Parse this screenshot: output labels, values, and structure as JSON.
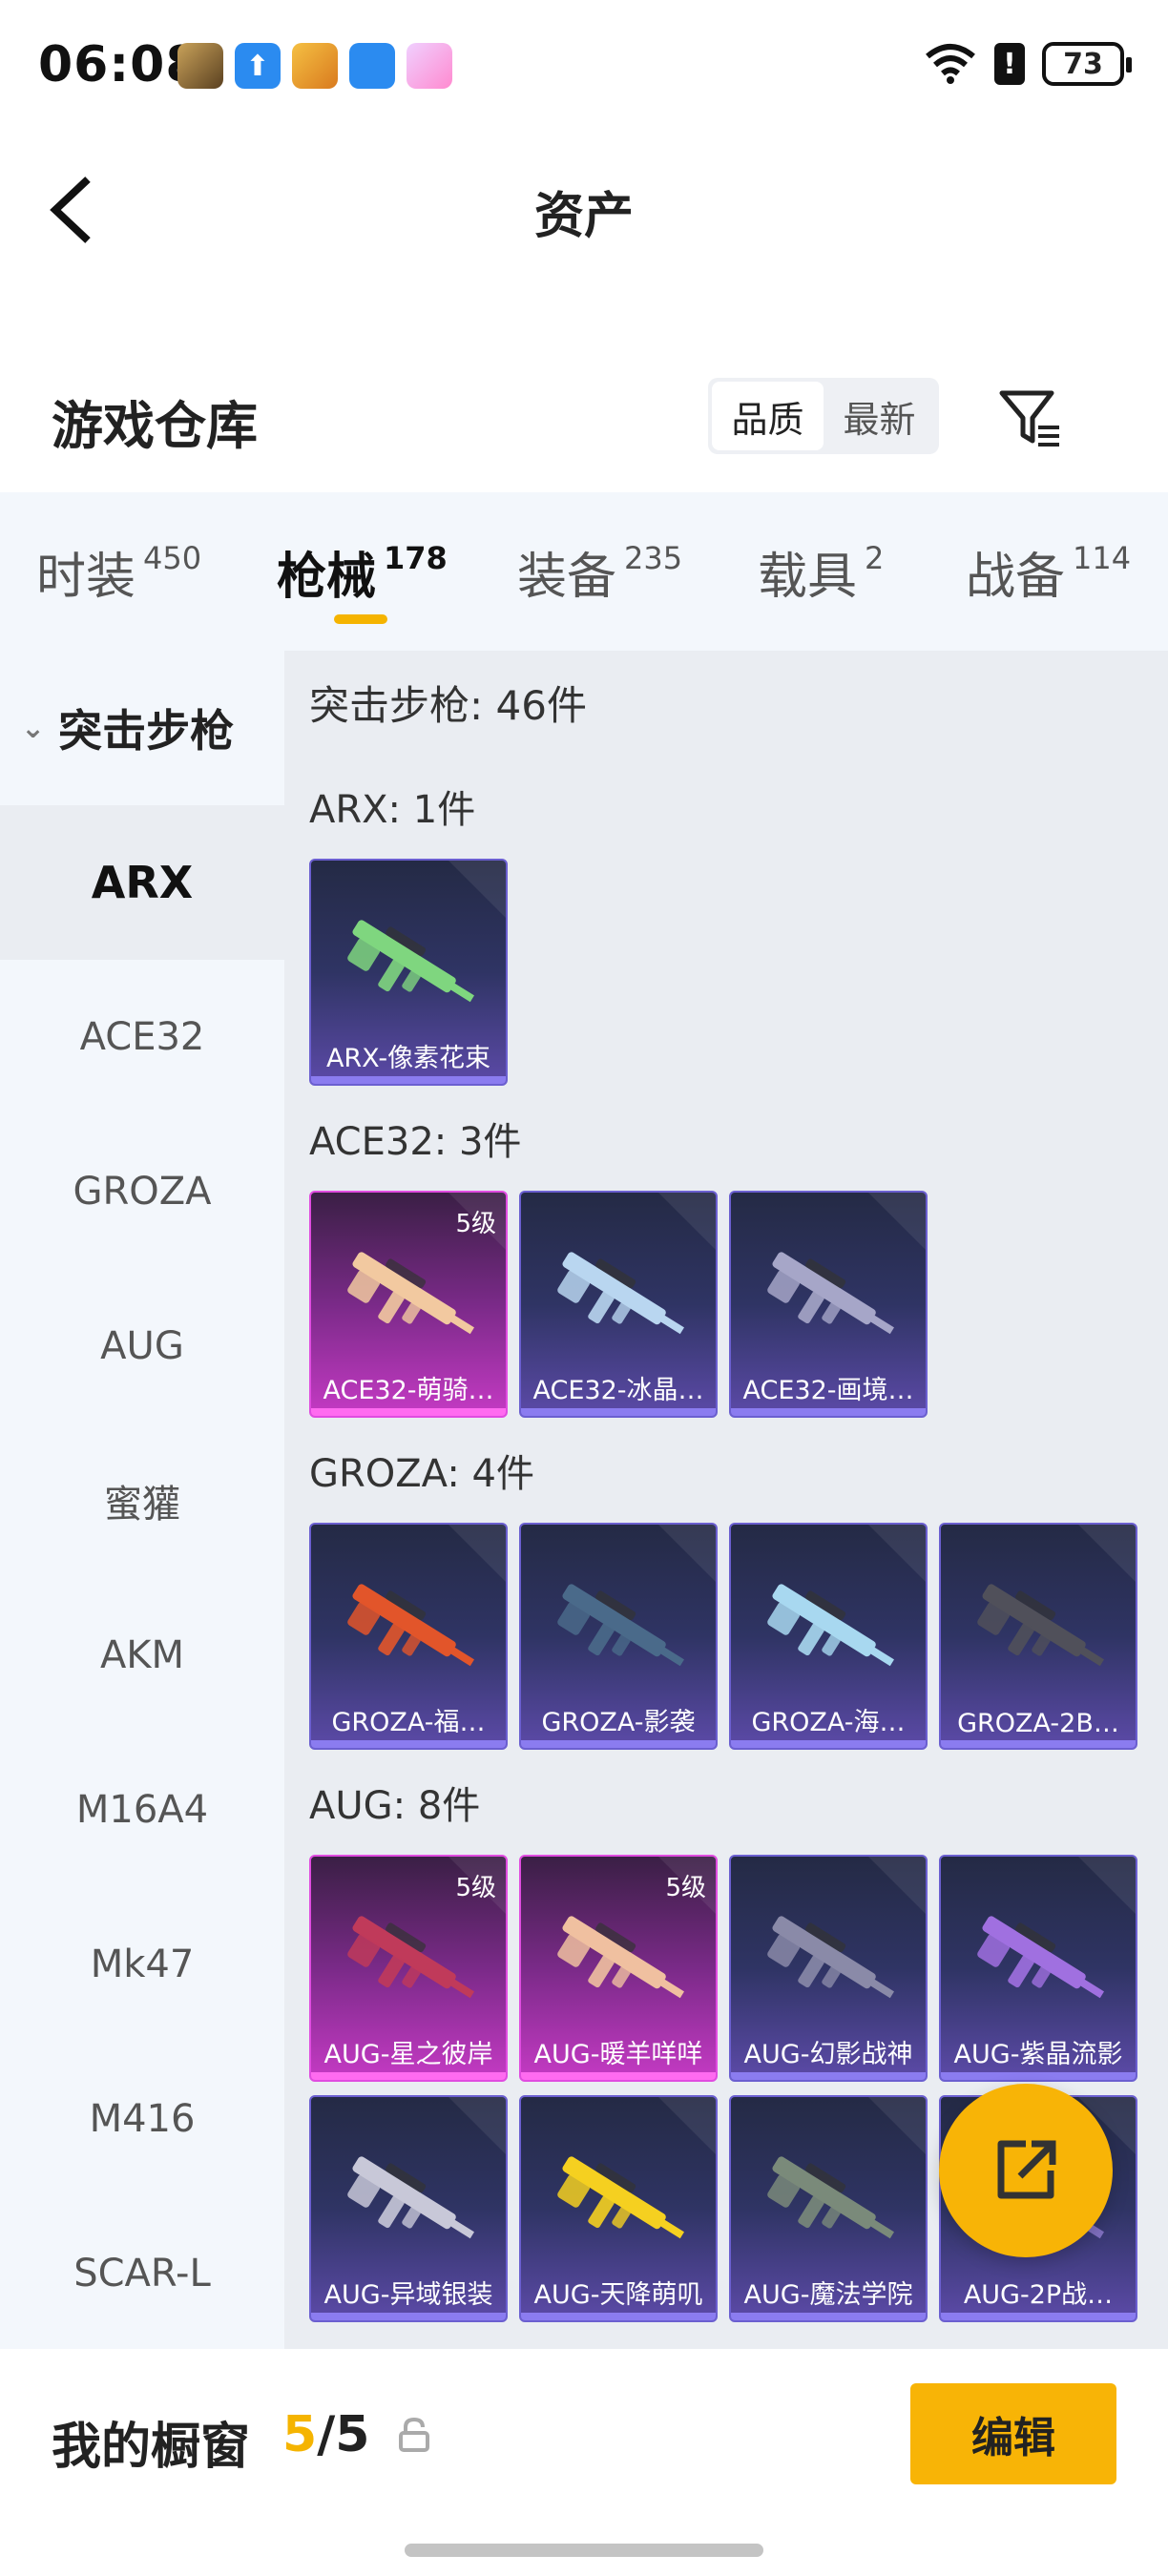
{
  "status_bar": {
    "time": "06:08",
    "battery": "73"
  },
  "header": {
    "title": "资产"
  },
  "warehouse": {
    "title": "游戏仓库",
    "sort_options": [
      "品质",
      "最新"
    ]
  },
  "tabs": [
    {
      "label": "时装",
      "count": "450"
    },
    {
      "label": "枪械",
      "count": "178"
    },
    {
      "label": "装备",
      "count": "235"
    },
    {
      "label": "载具",
      "count": "2"
    },
    {
      "label": "战备",
      "count": "114"
    }
  ],
  "sidebar": {
    "group": "突击步枪",
    "items": [
      "ARX",
      "ACE32",
      "GROZA",
      "AUG",
      "蜜獾",
      "AKM",
      "M16A4",
      "Mk47",
      "M416",
      "SCAR-L"
    ]
  },
  "content": {
    "category_title": "突击步枪: 46件",
    "sections": [
      {
        "title": "ARX: 1件",
        "items": [
          {
            "label": "ARX-像素花束",
            "badge": ""
          }
        ]
      },
      {
        "title": "ACE32: 3件",
        "items": [
          {
            "label": "ACE32-萌骑…",
            "badge": "5级"
          },
          {
            "label": "ACE32-冰晶…",
            "badge": ""
          },
          {
            "label": "ACE32-画境…",
            "badge": ""
          }
        ]
      },
      {
        "title": "GROZA: 4件",
        "items": [
          {
            "label": "GROZA-福…",
            "badge": ""
          },
          {
            "label": "GROZA-影袭",
            "badge": ""
          },
          {
            "label": "GROZA-海…",
            "badge": ""
          },
          {
            "label": "GROZA-2B…",
            "badge": ""
          }
        ]
      },
      {
        "title": "AUG: 8件",
        "items": [
          {
            "label": "AUG-星之彼岸",
            "badge": "5级"
          },
          {
            "label": "AUG-暖羊咩咩",
            "badge": "5级"
          },
          {
            "label": "AUG-幻影战神",
            "badge": ""
          },
          {
            "label": "AUG-紫晶流影",
            "badge": ""
          },
          {
            "label": "AUG-异域银装",
            "badge": ""
          },
          {
            "label": "AUG-天降萌叽",
            "badge": ""
          },
          {
            "label": "AUG-魔法学院",
            "badge": ""
          },
          {
            "label": "AUG-2P战…",
            "badge": ""
          }
        ]
      }
    ]
  },
  "bottom": {
    "showcase_label": "我的橱窗",
    "showcase_current": "5",
    "showcase_sep": "/",
    "showcase_total": "5",
    "edit_label": "编辑"
  },
  "colors": {
    "accent": "#f8b406",
    "tier_purple": "#6b5fd0",
    "tier_gold": "#e04ce0"
  },
  "icons": [
    "back-arrow-icon",
    "filter-icon",
    "share-icon",
    "lock-icon",
    "wifi-icon",
    "alert-icon",
    "battery-icon"
  ]
}
